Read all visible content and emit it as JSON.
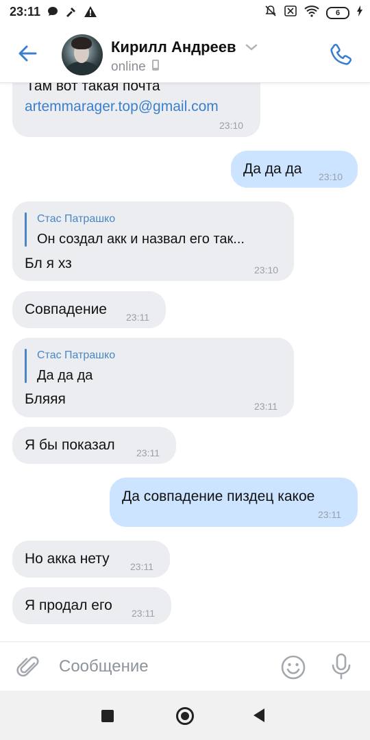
{
  "status_bar": {
    "time": "23:11",
    "battery": "6"
  },
  "header": {
    "name": "Кирилл Андреев",
    "status": "online"
  },
  "messages": [
    {
      "dir": "in",
      "text": "Там вот такая почта",
      "link": "artemmarager.top@gmail.com",
      "time": "23:10"
    },
    {
      "dir": "out",
      "text": "Да да да",
      "time": "23:10"
    },
    {
      "dir": "in",
      "reply_author": "Стас Патрашко",
      "reply_text": "Он создал акк и назвал его так...",
      "text": "Бл я хз",
      "time": "23:10"
    },
    {
      "dir": "in",
      "text": "Совпадение",
      "time": "23:11"
    },
    {
      "dir": "in",
      "reply_author": "Стас Патрашко",
      "reply_text": "Да да да",
      "text": "Бляяя",
      "time": "23:11"
    },
    {
      "dir": "in",
      "text": "Я бы показал",
      "time": "23:11"
    },
    {
      "dir": "out",
      "text": "Да совпадение пиздец какое",
      "time": "23:11"
    },
    {
      "dir": "in",
      "text": "Но акка нету",
      "time": "23:11"
    },
    {
      "dir": "in",
      "text": "Я продал его",
      "time": "23:11"
    }
  ],
  "composer": {
    "placeholder": "Сообщение"
  },
  "icons": {
    "accent": "#3b7fcc",
    "back": "arrow-left-icon",
    "call": "phone-icon",
    "attach": "paperclip-icon",
    "emoji": "smiley-icon",
    "mic": "microphone-icon"
  }
}
